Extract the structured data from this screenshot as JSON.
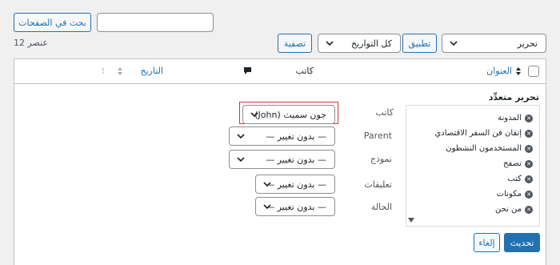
{
  "search": {
    "placeholder": "",
    "button_label": "بحث في الصفحات"
  },
  "items_count": "12 عنصر",
  "bulk_action": {
    "selected": "تحرير",
    "apply_label": "تطبيق"
  },
  "date_filter": {
    "selected": "كل التواريخ",
    "filter_label": "تصفية"
  },
  "columns": {
    "title": "العنوان",
    "author": "كاتب",
    "date": "التاريخ"
  },
  "bulk_edit": {
    "title": "تحرير متعدِّد",
    "categories": [
      "المدونة",
      "إتقان فن السفر الاقتصادي",
      "المستخدمون النشطون",
      "تصفح",
      "كتب",
      "مكونات",
      "من نحن"
    ],
    "fields": {
      "author": {
        "label": "كاتب",
        "value": "جون سميث (John)"
      },
      "parent": {
        "label": "Parent",
        "value": "— بدون تغيير —"
      },
      "template": {
        "label": "نموذج",
        "value": "— بدون تغيير —"
      },
      "comments": {
        "label": "تعليقات",
        "value": "— بدون تغيير —"
      },
      "status": {
        "label": "الحالة",
        "value": "— بدون تغيير —"
      }
    },
    "update_label": "تحديث",
    "cancel_label": "إلغاء"
  },
  "colors": {
    "accent": "#2271b1",
    "border": "#c3c4c7",
    "highlight": "#d63638"
  }
}
